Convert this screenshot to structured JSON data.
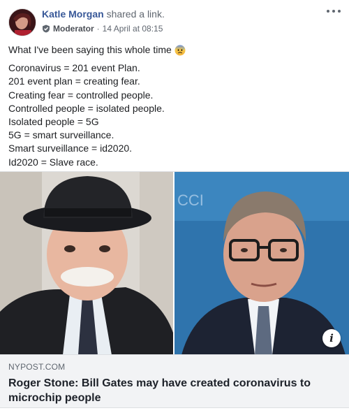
{
  "post": {
    "author_name": "Katle Morgan",
    "action": " shared a link.",
    "badge_label": "Moderator",
    "separator": "·",
    "timestamp": "14 April at 08:15",
    "intro_text": "What I've been saying this whole time",
    "intro_emoji": "anxious-face-with-sweat",
    "lines": [
      "Coronavirus = 201 event Plan.",
      "201 event plan = creating fear.",
      "Creating fear = controlled people.",
      "Controlled people = isolated people.",
      "Isolated people = 5G",
      "5G = smart surveillance.",
      "Smart surveillance = id2020.",
      "Id2020 = Slave race."
    ]
  },
  "link": {
    "domain": "NYPOST.COM",
    "title": "Roger Stone: Bill Gates may have created coronavirus to microchip people",
    "info_label": "i"
  },
  "icons": {
    "more": "more-options-icon",
    "badge": "moderator-badge-icon",
    "info": "info-icon"
  },
  "colors": {
    "author_link": "#385898",
    "secondary_text": "#606770",
    "caption_bg": "#f2f3f5"
  }
}
